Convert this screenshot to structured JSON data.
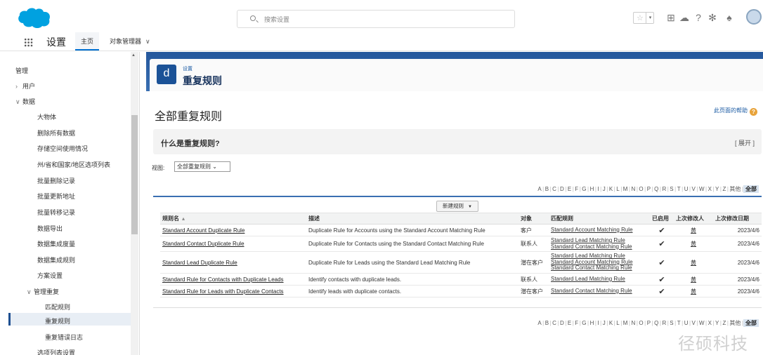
{
  "header": {
    "search_placeholder": "搜索设置"
  },
  "appnav": {
    "app_name": "设置",
    "tabs": [
      {
        "label": "主页"
      },
      {
        "label": "对象管理器"
      }
    ]
  },
  "sidebar": {
    "items": [
      {
        "label": "管理"
      },
      {
        "label": "用户"
      },
      {
        "label": "数据"
      },
      {
        "label": "大物体"
      },
      {
        "label": "删除所有数据"
      },
      {
        "label": "存储空间使用情况"
      },
      {
        "label": "州/省和国家/地区选项列表"
      },
      {
        "label": "批量删除记录"
      },
      {
        "label": "批量更新地址"
      },
      {
        "label": "批量转移记录"
      },
      {
        "label": "数据导出"
      },
      {
        "label": "数据集成度量"
      },
      {
        "label": "数据集成规则"
      },
      {
        "label": "方案设置"
      },
      {
        "label": "管理重复"
      },
      {
        "label": "匹配规则"
      },
      {
        "label": "重复规则"
      },
      {
        "label": "重复错误日志"
      },
      {
        "label": "选项列表设置"
      }
    ]
  },
  "page": {
    "breadcrumb": "设置",
    "title": "重复规则",
    "icon_letter": "d",
    "heading": "全部重复规则",
    "help_link": "此页面的帮助",
    "help_icon": "?",
    "what_title": "什么是重复规则?",
    "expand_label": "[ 展开 ]",
    "view_label": "视图:",
    "view_value": "全部重复规则",
    "new_button": "新建规则"
  },
  "alphabet": [
    "A",
    "B",
    "C",
    "D",
    "E",
    "F",
    "G",
    "H",
    "I",
    "J",
    "K",
    "L",
    "M",
    "N",
    "O",
    "P",
    "Q",
    "R",
    "S",
    "T",
    "U",
    "V",
    "W",
    "X",
    "Y",
    "Z",
    "其他",
    "全部"
  ],
  "table": {
    "columns": [
      "规则名",
      "描述",
      "对象",
      "匹配规则",
      "已启用",
      "上次修改人",
      "上次修改日期"
    ],
    "rows": [
      {
        "name": "Standard Account Duplicate Rule",
        "desc": "Duplicate Rule for Accounts using the Standard Account Matching Rule",
        "object": "客户",
        "matching": [
          "Standard Account Matching Rule"
        ],
        "enabled": "✔",
        "user": "黄",
        "date": "2023/4/6"
      },
      {
        "name": "Standard Contact Duplicate Rule",
        "desc": "Duplicate Rule for Contacts using the Standard Contact Matching Rule",
        "object": "联系人",
        "matching": [
          "Standard Lead Matching Rule",
          "Standard Contact Matching Rule"
        ],
        "enabled": "✔",
        "user": "黄",
        "date": "2023/4/6"
      },
      {
        "name": "Standard Lead Duplicate Rule",
        "desc": "Duplicate Rule for Leads using the Standard Lead Matching Rule",
        "object": "潜在客户",
        "matching": [
          "Standard Lead Matching Rule",
          "Standard Account Matching Rule",
          "Standard Contact Matching Rule"
        ],
        "enabled": "✔",
        "user": "黄",
        "date": "2023/4/6"
      },
      {
        "name": "Standard Rule for Contacts with Duplicate Leads",
        "desc": "Identify contacts with duplicate leads.",
        "object": "联系人",
        "matching": [
          "Standard Lead Matching Rule"
        ],
        "enabled": "✔",
        "user": "黄",
        "date": "2023/4/6"
      },
      {
        "name": "Standard Rule for Leads with Duplicate Contacts",
        "desc": "Identify leads with duplicate contacts.",
        "object": "潜在客户",
        "matching": [
          "Standard Contact Matching Rule"
        ],
        "enabled": "✔",
        "user": "黄",
        "date": "2023/4/6"
      }
    ]
  },
  "watermark": "径硕科技",
  "colors": {
    "brand_blue": "#1b5297",
    "banner_blue": "#24579c",
    "link_blue": "#1a5aa3",
    "help_orange": "#e8a33a",
    "salesforce_cloud": "#00a1e0"
  }
}
